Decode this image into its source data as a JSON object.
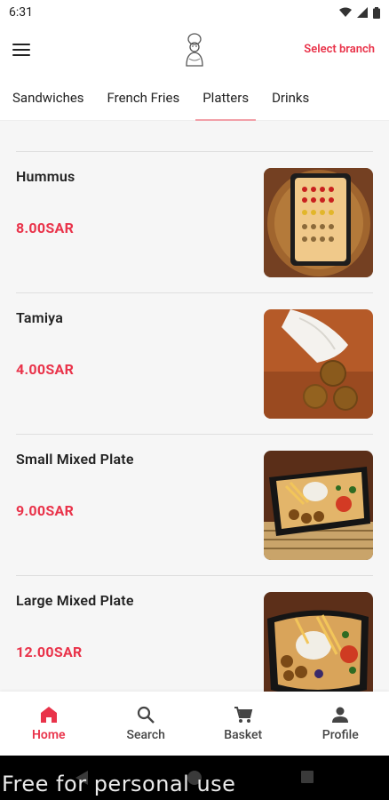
{
  "status_bar": {
    "time": "6:31"
  },
  "header": {
    "select_branch": "Select branch"
  },
  "tabs": [
    {
      "label": "Sandwiches"
    },
    {
      "label": "French Fries"
    },
    {
      "label": "Platters"
    },
    {
      "label": "Drinks"
    }
  ],
  "active_tab": "Platters",
  "items": [
    {
      "name": "Hummus",
      "price": "8.00SAR"
    },
    {
      "name": "Tamiya",
      "price": "4.00SAR"
    },
    {
      "name": "Small Mixed Plate",
      "price": "9.00SAR"
    },
    {
      "name": "Large Mixed Plate",
      "price": "12.00SAR"
    }
  ],
  "bottom_nav": [
    {
      "label": "Home",
      "icon": "home-icon"
    },
    {
      "label": "Search",
      "icon": "search-icon"
    },
    {
      "label": "Basket",
      "icon": "cart-icon"
    },
    {
      "label": "Profile",
      "icon": "person-icon"
    }
  ],
  "watermark": "Free for personal use",
  "colors": {
    "accent": "#e9334a",
    "tab_indicator": "#f2a0a8"
  }
}
